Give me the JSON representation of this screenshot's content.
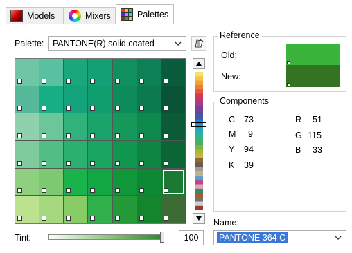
{
  "tabs": [
    {
      "label": "Models",
      "icon": "models-icon"
    },
    {
      "label": "Mixers",
      "icon": "mixers-icon"
    },
    {
      "label": "Palettes",
      "icon": "palettes-icon",
      "active": true
    }
  ],
  "palette": {
    "label": "Palette:",
    "selected": "PANTONE(R) solid coated"
  },
  "swatches": [
    [
      "#6fc6a7",
      "#59c1a0",
      "#19a87a",
      "#14a075",
      "#10905f",
      "#0d8055",
      "#0a5c3c"
    ],
    [
      "#55b99a",
      "#17ad85",
      "#13a27c",
      "#0f9f6e",
      "#0e8b5b",
      "#0b7a4f",
      "#0b5336"
    ],
    [
      "#8fd1ac",
      "#6cc699",
      "#31b27c",
      "#1aa36a",
      "#15985a",
      "#0f8a4e",
      "#0b5b37"
    ],
    [
      "#7fcb9b",
      "#53bd86",
      "#2bb070",
      "#18a55f",
      "#11964f",
      "#0e8443",
      "#0b6535"
    ],
    [
      "#8ed07f",
      "#7cc971",
      "#19b24b",
      "#13a744",
      "#10973a",
      "#0d8936",
      "#1a7a34"
    ],
    [
      "#bce28f",
      "#a6d87f",
      "#88cc67",
      "#2fb04a",
      "#259a38",
      "#14852d",
      "#3d6b35"
    ]
  ],
  "selected_swatch": {
    "row": 4,
    "col": 6
  },
  "strip_colors": [
    "#f8e26a",
    "#f4c542",
    "#f2a23a",
    "#ee7d3a",
    "#e85a3c",
    "#d43a4c",
    "#c43577",
    "#a63b8f",
    "#7a3f96",
    "#5a4aa0",
    "#3c5bb0",
    "#2f7ac0",
    "#2a94c8",
    "#2aa8b8",
    "#2cb49a",
    "#33b27a",
    "#4fae5a",
    "#7ab444",
    "#a8b83a",
    "#c9b23a",
    "#8a6a3a",
    "#6a5a4a",
    "#9c9c9c",
    "#c0b28a",
    "#5aa0c8",
    "#b84a8a",
    "#e8a0b8",
    "#3a8a6a",
    "#a85a2a",
    "#707070",
    "#d0d0d0",
    "#9a3a3a"
  ],
  "reference": {
    "title": "Reference",
    "old_label": "Old:",
    "new_label": "New:",
    "old_color": "#3ab43a",
    "new_color": "#337321"
  },
  "components": {
    "title": "Components",
    "cmyk": [
      {
        "label": "C",
        "value": "73"
      },
      {
        "label": "M",
        "value": "9"
      },
      {
        "label": "Y",
        "value": "94"
      },
      {
        "label": "K",
        "value": "39"
      }
    ],
    "rgb": [
      {
        "label": "R",
        "value": "51"
      },
      {
        "label": "G",
        "value": "115"
      },
      {
        "label": "B",
        "value": "33"
      }
    ]
  },
  "tint": {
    "label": "Tint:",
    "value": "100",
    "level": 1.0
  },
  "name": {
    "label": "Name:",
    "value": "PANTONE 364 C"
  }
}
